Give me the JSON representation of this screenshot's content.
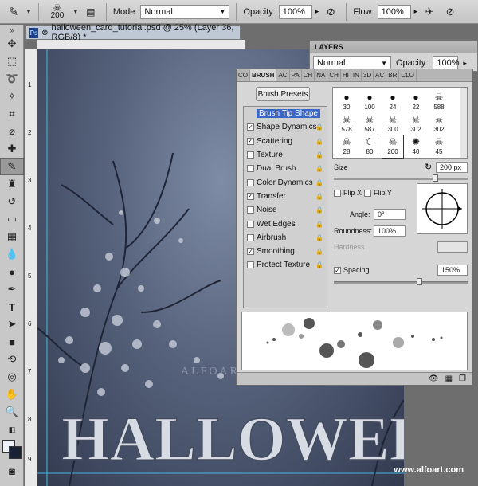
{
  "options_bar": {
    "brush_size": "200",
    "mode_label": "Mode:",
    "mode_value": "Normal",
    "opacity_label": "Opacity:",
    "opacity_value": "100%",
    "flow_label": "Flow:",
    "flow_value": "100%"
  },
  "document": {
    "tab_title": "halloween_card_tutorial.psd @ 25% (Layer 36, RGB/8) *",
    "ps_badge": "Ps",
    "ruler_marks": [
      "1",
      "2",
      "3",
      "4",
      "5",
      "6",
      "7",
      "8",
      "9"
    ],
    "watermark": "www.alfoart.com"
  },
  "layers_panel": {
    "title": "LAYERS",
    "blend_mode": "Normal",
    "opacity_label": "Opacity:",
    "opacity_value": "100%"
  },
  "brush_panel": {
    "tabs": [
      "CO",
      "BRUSH",
      "AC",
      "PA",
      "CH",
      "NA",
      "CH",
      "HI",
      "IN",
      "3D",
      "AC",
      "BR",
      "CLO"
    ],
    "presets_button": "Brush Presets",
    "options": [
      {
        "label": "Brush Tip Shape",
        "checked": false,
        "selected": true,
        "lock": false
      },
      {
        "label": "Shape Dynamics",
        "checked": true,
        "selected": false,
        "lock": true
      },
      {
        "label": "Scattering",
        "checked": true,
        "selected": false,
        "lock": true
      },
      {
        "label": "Texture",
        "checked": false,
        "selected": false,
        "lock": true
      },
      {
        "label": "Dual Brush",
        "checked": false,
        "selected": false,
        "lock": true
      },
      {
        "label": "Color Dynamics",
        "checked": false,
        "selected": false,
        "lock": true
      },
      {
        "label": "Transfer",
        "checked": true,
        "selected": false,
        "lock": true
      },
      {
        "label": "Noise",
        "checked": false,
        "selected": false,
        "lock": true
      },
      {
        "label": "Wet Edges",
        "checked": false,
        "selected": false,
        "lock": true
      },
      {
        "label": "Airbrush",
        "checked": false,
        "selected": false,
        "lock": true
      },
      {
        "label": "Smoothing",
        "checked": true,
        "selected": false,
        "lock": true
      },
      {
        "label": "Protect Texture",
        "checked": false,
        "selected": false,
        "lock": true
      }
    ],
    "tips": [
      "30",
      "100",
      "24",
      "22",
      "588",
      "578",
      "587",
      "300",
      "302",
      "302",
      "28",
      "80",
      "200",
      "40",
      "45"
    ],
    "size_label": "Size",
    "size_value": "200 px",
    "flip_x": "Flip X",
    "flip_y": "Flip Y",
    "angle_label": "Angle:",
    "angle_value": "0°",
    "roundness_label": "Roundness:",
    "roundness_value": "100%",
    "hardness_label": "Hardness",
    "spacing_label": "Spacing",
    "spacing_value": "150%"
  }
}
